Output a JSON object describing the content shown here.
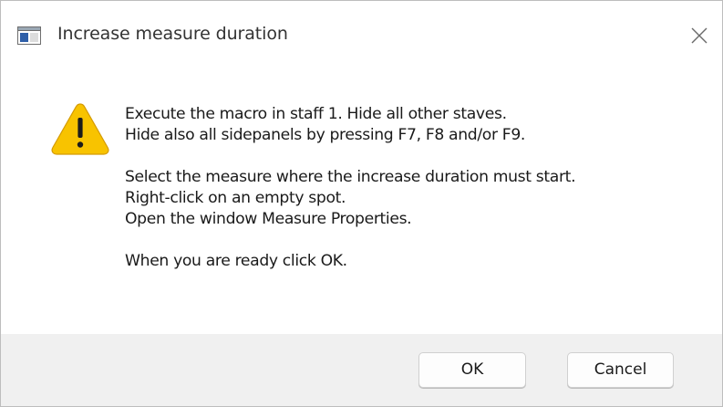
{
  "window": {
    "title": "Increase measure duration",
    "app_icon": "window-app-icon",
    "close_icon": "close-icon"
  },
  "message": {
    "icon": "warning-icon",
    "icon_color": "#f8c300",
    "lines": [
      "Execute the macro in staff 1. Hide all other staves.",
      "Hide also all sidepanels by pressing F7, F8 and/or F9.",
      "Select the measure where the increase duration must start.",
      "Right-click on an empty spot.",
      "Open the window Measure Properties.",
      "When you are ready click OK."
    ]
  },
  "buttons": {
    "ok_label": "OK",
    "cancel_label": "Cancel"
  }
}
